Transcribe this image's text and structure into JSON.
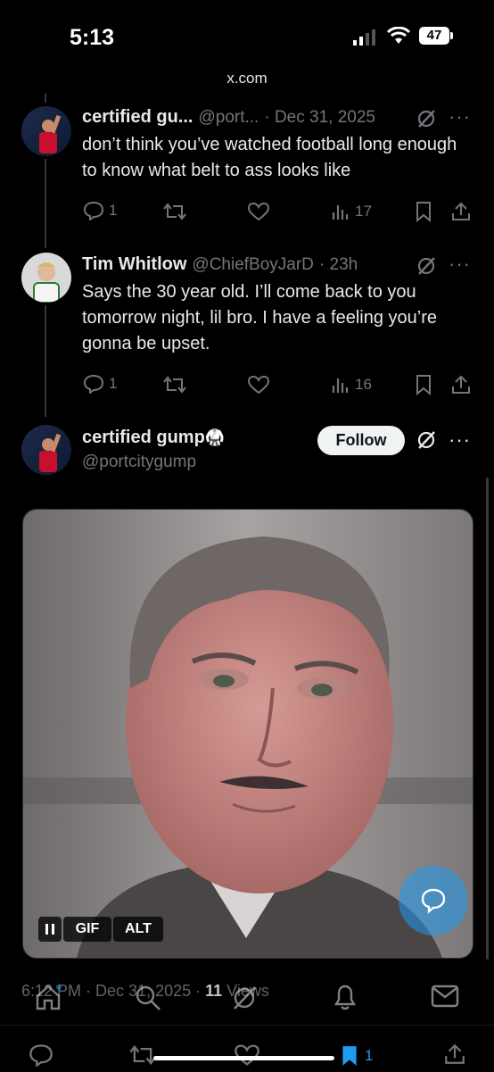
{
  "status_bar": {
    "time": "5:13",
    "battery": "47"
  },
  "browser": {
    "url": "x.com"
  },
  "posts": [
    {
      "name": "certified gu...",
      "handle": "@port...",
      "time": "· Dec 31, 2025",
      "text": "don’t think you’ve watched football long enough to know what belt to ass looks like",
      "replies": "1",
      "views": "17"
    },
    {
      "name": "Tim Whitlow",
      "handle": "@ChiefBoyJarD",
      "time": "· 23h",
      "text": "Says the 30 year old. I’ll come back to you tomorrow night, lil bro. I have a feeling you’re gonna be upset.",
      "replies": "1",
      "views": "16"
    }
  ],
  "focused_post": {
    "name": "certified gump",
    "name_emoji": "🥋",
    "handle": "@portcitygump",
    "follow_label": "Follow",
    "media_badges": {
      "gif": "GIF",
      "alt": "ALT"
    },
    "timestamp": "6:12 PM · Dec 31, 2025 ·",
    "views_count": "11",
    "views_label": "Views",
    "bookmarks": "1"
  },
  "colors": {
    "accent": "#1d9bf0",
    "muted": "#71767b",
    "text": "#e7e9ea"
  },
  "icons": [
    "grok-icon",
    "more-icon",
    "reply-icon",
    "repost-icon",
    "like-icon",
    "views-icon",
    "bookmark-icon",
    "share-icon",
    "home-icon",
    "search-icon",
    "notifications-icon",
    "messages-icon"
  ]
}
